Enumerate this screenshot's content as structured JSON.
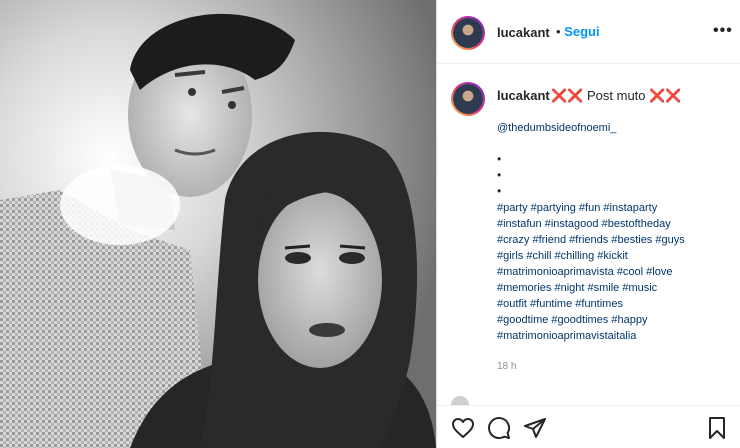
{
  "post": {
    "username": "lucakant",
    "follow_label": "Segui",
    "separator": "•",
    "more_label": "•••"
  },
  "caption": {
    "username": "lucakant",
    "text": "❌❌ Post muto ❌❌",
    "mention": "@thedumbsideofnoemi_",
    "bullets": [
      "•",
      "•",
      "•"
    ],
    "hashtag_lines": [
      "#party #partying #fun #instaparty",
      "#instafun #instagood #bestoftheday",
      "#crazy #friend #friends #besties #guys",
      "#girls #chill #chilling #kickit",
      "#matrimonioaprimavista #cool #love",
      "#memories #night #smile #music",
      "#outfit #funtime #funtimes",
      "#goodtime #goodtimes #happy",
      "#matrimonioaprimavistaitalia"
    ],
    "time": "18 h"
  },
  "actions": {
    "like_icon": "heart-icon",
    "comment_icon": "comment-icon",
    "share_icon": "share-icon",
    "save_icon": "bookmark-icon"
  },
  "colors": {
    "link": "#00376b",
    "accent": "#0095f6",
    "text": "#262626",
    "muted": "#8e8e8e"
  }
}
